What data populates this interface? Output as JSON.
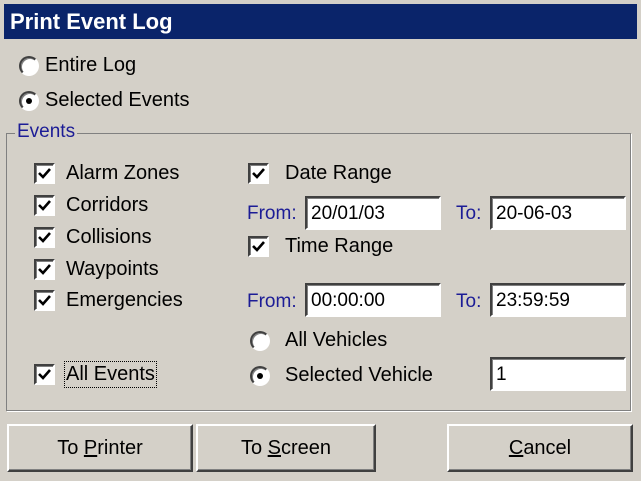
{
  "dialog": {
    "title": "Print Event Log"
  },
  "scope": {
    "entire_log_label": "Entire Log",
    "selected_events_label": "Selected Events",
    "selected": "selected_events"
  },
  "events": {
    "group_label": "Events",
    "types": [
      {
        "label": "Alarm Zones",
        "checked": true
      },
      {
        "label": "Corridors",
        "checked": true
      },
      {
        "label": "Collisions",
        "checked": true
      },
      {
        "label": "Waypoints",
        "checked": true
      },
      {
        "label": "Emergencies",
        "checked": true
      }
    ],
    "all_events_label": "All Events",
    "all_events_checked": true
  },
  "date_range": {
    "label": "Date Range",
    "checked": true,
    "from_label": "From:",
    "from_value": "20/01/03",
    "to_label": "To:",
    "to_value": "20-06-03"
  },
  "time_range": {
    "label": "Time Range",
    "checked": true,
    "from_label": "From:",
    "from_value": "00:00:00",
    "to_label": "To:",
    "to_value": "23:59:59"
  },
  "vehicles": {
    "all_label": "All Vehicles",
    "selected_label": "Selected Vehicle",
    "selected": "selected_vehicle",
    "vehicle_value": "1"
  },
  "buttons": {
    "to_printer_pre": "To ",
    "to_printer_mn": "P",
    "to_printer_post": "rinter",
    "to_screen_pre": "To ",
    "to_screen_mn": "S",
    "to_screen_post": "creen",
    "cancel_mn": "C",
    "cancel_post": "ancel"
  },
  "colors": {
    "titlebar": "#0a246a",
    "dialog_bg": "#d4d0c8",
    "label_blue": "#1c1c96"
  }
}
